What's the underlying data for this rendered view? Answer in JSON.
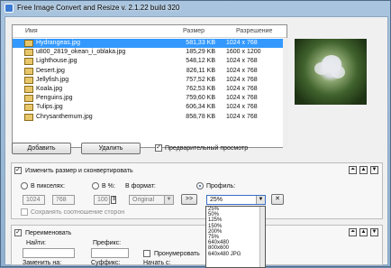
{
  "window": {
    "title": "Free Image Convert and Resize  v. 2.1.22 build 320"
  },
  "filelist": {
    "headers": {
      "name": "Имя",
      "size": "Размер",
      "resolution": "Разрешение"
    },
    "rows": [
      {
        "name": "Hydrangeas.jpg",
        "size": "581,33 KB",
        "res": "1024 x 768",
        "selected": true
      },
      {
        "name": "u800_2819_okean_i_oblaka.jpg",
        "size": "185,29 KB",
        "res": "1600 x 1200"
      },
      {
        "name": "Lighthouse.jpg",
        "size": "548,12 KB",
        "res": "1024 x 768"
      },
      {
        "name": "Desert.jpg",
        "size": "826,11 KB",
        "res": "1024 x 768"
      },
      {
        "name": "Jellyfish.jpg",
        "size": "757,52 KB",
        "res": "1024 x 768"
      },
      {
        "name": "Koala.jpg",
        "size": "762,53 KB",
        "res": "1024 x 768"
      },
      {
        "name": "Penguins.jpg",
        "size": "759,60 KB",
        "res": "1024 x 768"
      },
      {
        "name": "Tulips.jpg",
        "size": "606,34 KB",
        "res": "1024 x 768"
      },
      {
        "name": "Chrysanthemum.jpg",
        "size": "858,78 KB",
        "res": "1024 x 768"
      }
    ]
  },
  "actions": {
    "add": "Добавить",
    "remove": "Удалить",
    "preview": "Предварительный просмотр"
  },
  "resize": {
    "section_label": "Изменить размер и сконвертировать",
    "pixels_label": "В пикселях:",
    "percent_label": "В %:",
    "format_label": "В формат:",
    "profile_label": "Профиль:",
    "width": "1024",
    "height": "768",
    "percent": "100",
    "format": "Original",
    "apply": ">>",
    "profile": "25%",
    "keep_ratio": "Сохранять соотношение сторон",
    "close": "✕"
  },
  "profile_options": [
    "25%",
    "50%",
    "125%",
    "150%",
    "200%",
    "75%",
    "640x480",
    "800x600",
    "640x480 JPG"
  ],
  "rename": {
    "section_label": "Переименовать",
    "find_label": "Найти:",
    "prefix_label": "Префикс:",
    "numbering_label": "Пронумеровать",
    "replace_label": "Заменить на:",
    "suffix_label": "Суффикс:",
    "start_label": "Начать с:"
  },
  "colors": {
    "selection": "#3399ff",
    "title_gradient": "#a9c4de"
  }
}
